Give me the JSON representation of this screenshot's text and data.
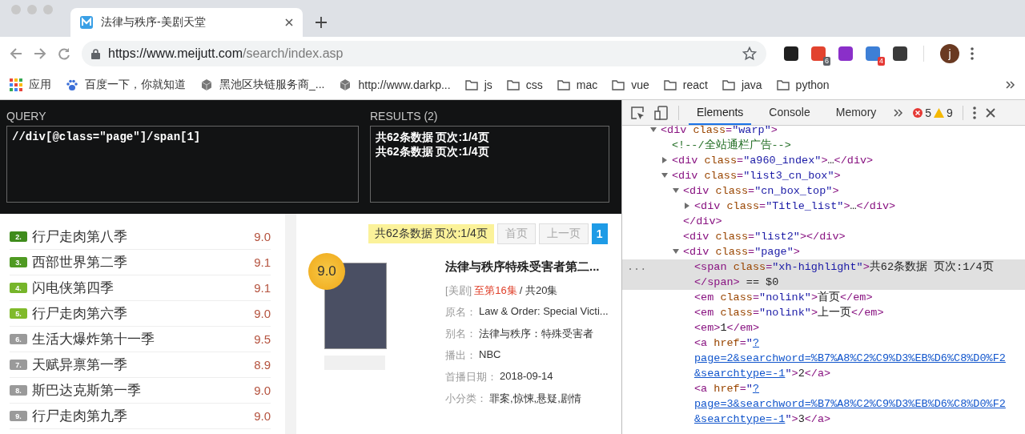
{
  "browser": {
    "tab": {
      "title": "法律与秩序-美剧天堂"
    },
    "url": {
      "host": "https://www.meijutt.com",
      "path": "/search/index.asp"
    },
    "extensions": [
      {
        "color": "#1f1f1f"
      },
      {
        "color": "#e2432f",
        "badge": {
          "text": "6",
          "color": "#5f6368"
        }
      },
      {
        "color": "#8a2fc9"
      },
      {
        "color": "#3d7fd6",
        "badge": {
          "text": "4",
          "color": "#e53935"
        }
      },
      {
        "color": "#3a3a3a"
      }
    ],
    "profile_initial": "j",
    "bookmarks": [
      {
        "kind": "apps",
        "label": "应用"
      },
      {
        "kind": "paw",
        "label": "百度一下，你就知道"
      },
      {
        "kind": "cube",
        "label": "黑池区块链服务商_..."
      },
      {
        "kind": "cube",
        "label": "http://www.darkp..."
      },
      {
        "kind": "folder",
        "label": "js"
      },
      {
        "kind": "folder",
        "label": "css"
      },
      {
        "kind": "folder",
        "label": "mac"
      },
      {
        "kind": "folder",
        "label": "vue"
      },
      {
        "kind": "folder",
        "label": "react"
      },
      {
        "kind": "folder",
        "label": "java"
      },
      {
        "kind": "folder",
        "label": "python"
      }
    ]
  },
  "xpath_helper": {
    "query_label": "QUERY",
    "query": "//div[@class=\"page\"]/span[1]",
    "results_label": "RESULTS (2)",
    "results": [
      "共62条数据 页次:1/4页",
      "共62条数据 页次:1/4页"
    ]
  },
  "ranking": [
    {
      "rank": "2.",
      "title": "行尸走肉第八季",
      "score": "9.0",
      "color": "#3f8c1c"
    },
    {
      "rank": "3.",
      "title": "西部世界第二季",
      "score": "9.1",
      "color": "#4f9a22"
    },
    {
      "rank": "4.",
      "title": "闪电侠第四季",
      "score": "9.1",
      "color": "#76b52a"
    },
    {
      "rank": "5.",
      "title": "行尸走肉第六季",
      "score": "9.0",
      "color": "#80ba2a"
    },
    {
      "rank": "6.",
      "title": "生活大爆炸第十一季",
      "score": "9.5",
      "color": "#9a9a9a"
    },
    {
      "rank": "7.",
      "title": "天赋异禀第一季",
      "score": "8.9",
      "color": "#9a9a9a"
    },
    {
      "rank": "8.",
      "title": "斯巴达克斯第一季",
      "score": "9.0",
      "color": "#9a9a9a"
    },
    {
      "rank": "9.",
      "title": "行尸走肉第九季",
      "score": "9.0",
      "color": "#9a9a9a"
    }
  ],
  "pagination": {
    "summary": "共62条数据 页次:1/4页",
    "buttons": [
      {
        "label": "首页",
        "disabled": true,
        "selected": false
      },
      {
        "label": "上一页",
        "disabled": true,
        "selected": false
      },
      {
        "label": "1",
        "disabled": false,
        "selected": true
      }
    ]
  },
  "result": {
    "score": "9.0",
    "title": "法律与秩序特殊受害者第二...",
    "episode_info": [
      {
        "text": "[美剧]",
        "color": "#999999"
      },
      {
        "text": "至第16集",
        "color": "#e0402a"
      },
      {
        "text": "/ 共20集",
        "color": "#333333"
      }
    ],
    "fields": [
      {
        "label": "原名：",
        "value": "Law & Order: Special Victi..."
      },
      {
        "label": "别名：",
        "value": "法律与秩序：特殊受害者"
      },
      {
        "label": "播出：",
        "value": "NBC"
      },
      {
        "label": "首播日期：",
        "value": "2018-09-14"
      },
      {
        "label": "小分类：",
        "value": "罪案,惊悚,悬疑,剧情"
      }
    ]
  },
  "devtools": {
    "tabs": [
      {
        "label": "Elements",
        "selected": true
      },
      {
        "label": "Console",
        "selected": false
      },
      {
        "label": "Memory",
        "selected": false
      }
    ],
    "errors": "5",
    "warnings": "9",
    "selected_gutter": "...",
    "dom": [
      {
        "text": "<div class=\"warp\">",
        "expanded": true,
        "children": [
          {
            "text": "<!--/全站通栏广告-->"
          },
          {
            "text": "<div class=\"a960_index\">…</div>",
            "expanded": false
          },
          {
            "text": "<div class=\"list3_cn_box\">",
            "expanded": true,
            "children": [
              {
                "text": "<div class=\"cn_box_top\">",
                "expanded": true,
                "close": "</div>",
                "children": [
                  {
                    "text": "<div class=\"Title_list\">…</div>",
                    "expanded": false
                  }
                ]
              },
              {
                "text": "<div class=\"list2\"></div>"
              },
              {
                "text": "<div class=\"page\">",
                "expanded": true,
                "children": [
                  {
                    "text": "<span class=\"xh-highlight\">共62条数据 页次:1/4页\n</span> == $0",
                    "selected": true
                  },
                  {
                    "text": "<em class=\"nolink\">首页</em>",
                    "selected": false
                  },
                  {
                    "text": "<em class=\"nolink\">上一页</em>",
                    "selected": false
                  },
                  {
                    "text": "<em>1</em>",
                    "selected": false
                  },
                  {
                    "text": "<a href=\"?\npage=2&searchword=%B7%A8%C2%C9%D3%EB%D6%C8%D0%F2\n&searchtype=-1\">2</a>",
                    "link": true,
                    "selected": false
                  },
                  {
                    "text": "<a href=\"?\npage=3&searchword=%B7%A8%C2%C9%D3%EB%D6%C8%D0%F2\n&searchtype=-1\">3</a>",
                    "link": true,
                    "selected": false
                  }
                ]
              }
            ]
          }
        ]
      }
    ]
  }
}
